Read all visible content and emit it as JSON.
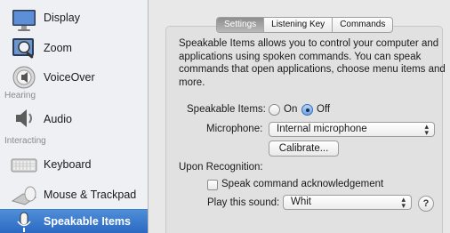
{
  "sidebar": {
    "items": [
      {
        "label": "Display",
        "icon": "display-icon"
      },
      {
        "label": "Zoom",
        "icon": "zoom-icon"
      },
      {
        "label": "VoiceOver",
        "icon": "voiceover-icon"
      },
      {
        "label": "Audio",
        "icon": "audio-icon"
      },
      {
        "label": "Keyboard",
        "icon": "keyboard-icon"
      },
      {
        "label": "Mouse & Trackpad",
        "icon": "mouse-trackpad-icon"
      },
      {
        "label": "Speakable Items",
        "icon": "microphone-icon",
        "selected": true
      }
    ],
    "sections": {
      "hearing": "Hearing",
      "interacting": "Interacting"
    },
    "selected_color": "#2b69c2"
  },
  "tabs": [
    {
      "label": "Settings",
      "active": true
    },
    {
      "label": "Listening Key",
      "active": false
    },
    {
      "label": "Commands",
      "active": false
    }
  ],
  "description": "Speakable Items allows you to control your computer and applications using spoken commands. You can speak commands that open applications, choose menu items and more.",
  "speakable_items": {
    "label": "Speakable Items:",
    "on_label": "On",
    "off_label": "Off",
    "selected": "Off"
  },
  "microphone": {
    "label": "Microphone:",
    "value": "Internal microphone"
  },
  "calibrate_label": "Calibrate...",
  "upon_recognition": {
    "label": "Upon Recognition:",
    "ack_label": "Speak command acknowledgement",
    "ack_checked": false,
    "play_sound_label": "Play this sound:",
    "play_sound_value": "Whit"
  },
  "help_label": "?"
}
